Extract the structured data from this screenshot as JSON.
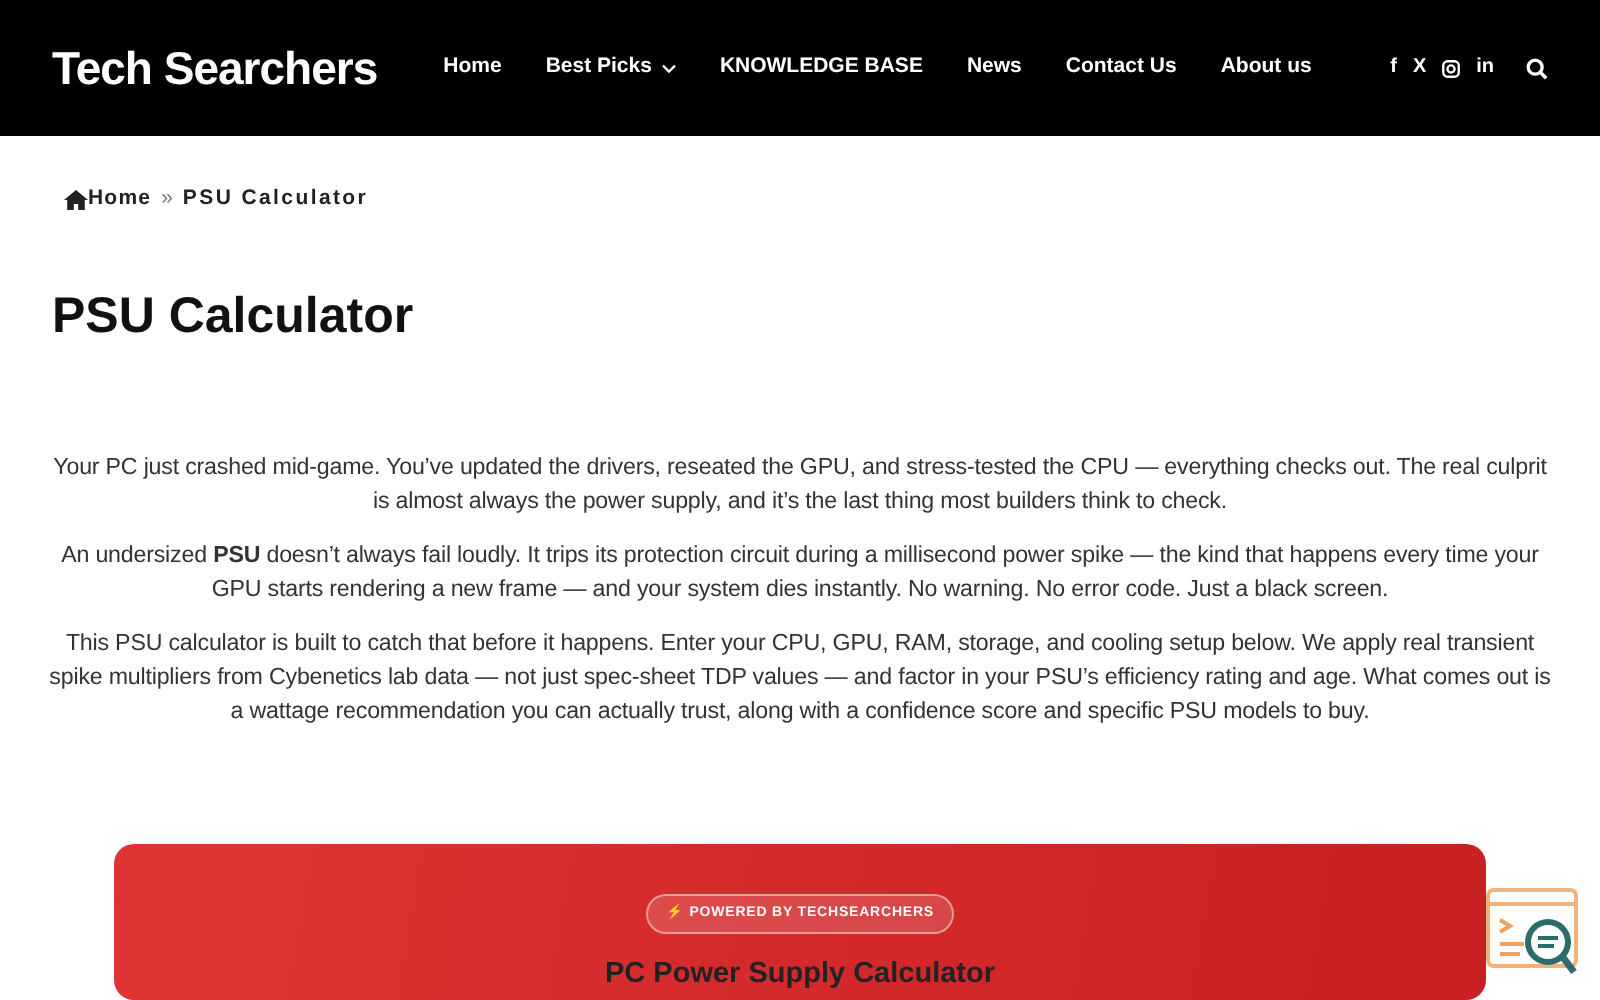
{
  "header": {
    "logo": "Tech Searchers",
    "nav": [
      {
        "label": "Home",
        "kind": "link"
      },
      {
        "label": "Best Picks",
        "kind": "dropdown"
      },
      {
        "label": "KNOWLEDGE BASE",
        "kind": "link"
      },
      {
        "label": "News",
        "kind": "link"
      },
      {
        "label": "Contact Us",
        "kind": "link"
      },
      {
        "label": "About us",
        "kind": "link"
      }
    ],
    "social": [
      {
        "kind": "glyph",
        "text": "f"
      },
      {
        "kind": "glyph",
        "text": "X"
      },
      {
        "kind": "camera"
      },
      {
        "kind": "glyph",
        "text": "in"
      }
    ]
  },
  "breadcrumb": {
    "home": "Home",
    "separator": "»",
    "current": "PSU Calculator"
  },
  "title": "PSU Calculator",
  "paragraphs": [
    "Your PC just crashed mid-game. You’ve updated the drivers, reseated the GPU, and stress-tested the CPU — everything checks out. The real culprit is almost always the power supply, and it’s the last thing most builders think to check.",
    "An undersized **PSU** doesn’t always fail loudly. It trips its protection circuit during a millisecond power spike — the kind that happens every time your GPU starts rendering a new frame — and your system dies instantly. No warning. No error code. Just a black screen.",
    "This PSU calculator is built to catch that before it happens. Enter your CPU, GPU, RAM, storage, and cooling setup below. We apply real transient spike multipliers from Cybenetics lab data — not just spec-sheet TDP values — and factor in your PSU’s efficiency rating and age. What comes out is a wattage recommendation you can actually trust, along with a confidence score and specific PSU models to buy."
  ],
  "calculator": {
    "badge": "⚡ POWERED BY TECHSEARCHERS",
    "title": "PC Power Supply Calculator"
  }
}
